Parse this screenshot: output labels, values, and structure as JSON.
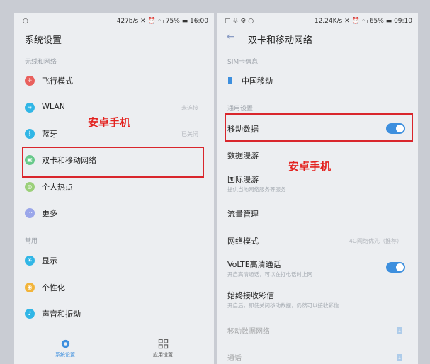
{
  "left": {
    "status": {
      "left": "○",
      "right": "427b/s ✕ ⏰ ◦ᵢₗ 75% ▬ 16:00"
    },
    "title": "系统设置",
    "section1": "无线和网络",
    "section2": "常用",
    "items": [
      {
        "label": "飞行模式",
        "icon": "airplane-icon",
        "color": "#e9605d"
      },
      {
        "label": "WLAN",
        "value": "未连接",
        "icon": "wifi-icon",
        "color": "#31b6e6"
      },
      {
        "label": "蓝牙",
        "value": "已关闭",
        "icon": "bluetooth-icon",
        "color": "#31b6e6"
      },
      {
        "label": "双卡和移动网络",
        "icon": "sim-icon",
        "color": "#67c98a"
      },
      {
        "label": "个人热点",
        "icon": "hotspot-icon",
        "color": "#9bd07a"
      },
      {
        "label": "更多",
        "icon": "more-icon",
        "color": "#9aa6ea"
      },
      {
        "label": "显示",
        "icon": "display-icon",
        "color": "#31b6e6"
      },
      {
        "label": "个性化",
        "icon": "theme-icon",
        "color": "#f2b43a"
      },
      {
        "label": "声音和振动",
        "icon": "sound-icon",
        "color": "#31b6e6"
      }
    ],
    "tabs": [
      {
        "label": "系统设置"
      },
      {
        "label": "应用设置"
      }
    ]
  },
  "right": {
    "status": {
      "left": "▢ ♧ ⚙ ○",
      "right": "12.24K/s ✕ ⏰ ◦ᵢₗ 65% ▬ 09:10"
    },
    "back": "←",
    "title": "双卡和移动网络",
    "section1": "SIM卡信息",
    "sim_label": "中国移动",
    "section2": "通用设置",
    "items": [
      {
        "label": "移动数据",
        "toggle": true
      },
      {
        "label": "数据漫游"
      },
      {
        "label": "国际漫游",
        "sub": "提供当地网络服务等服务"
      },
      {
        "label": "流量管理"
      },
      {
        "label": "网络模式",
        "value": "4G网络优先（推荐）"
      },
      {
        "label": "VoLTE高清通话",
        "sub": "开启高清通话，可以在打电话时上网",
        "toggle": true
      },
      {
        "label": "始终接收彩信",
        "sub": "开启后，即使关闭移动数据，仍然可以接收彩信"
      },
      {
        "label": "移动数据网络",
        "sim": "1"
      },
      {
        "label": "通话",
        "sim": "1"
      }
    ]
  },
  "watermark": "安卓手机",
  "colors": {
    "accent": "#3d8fde",
    "highlight_box": "#d9262c",
    "watermark": "#e3221f"
  }
}
